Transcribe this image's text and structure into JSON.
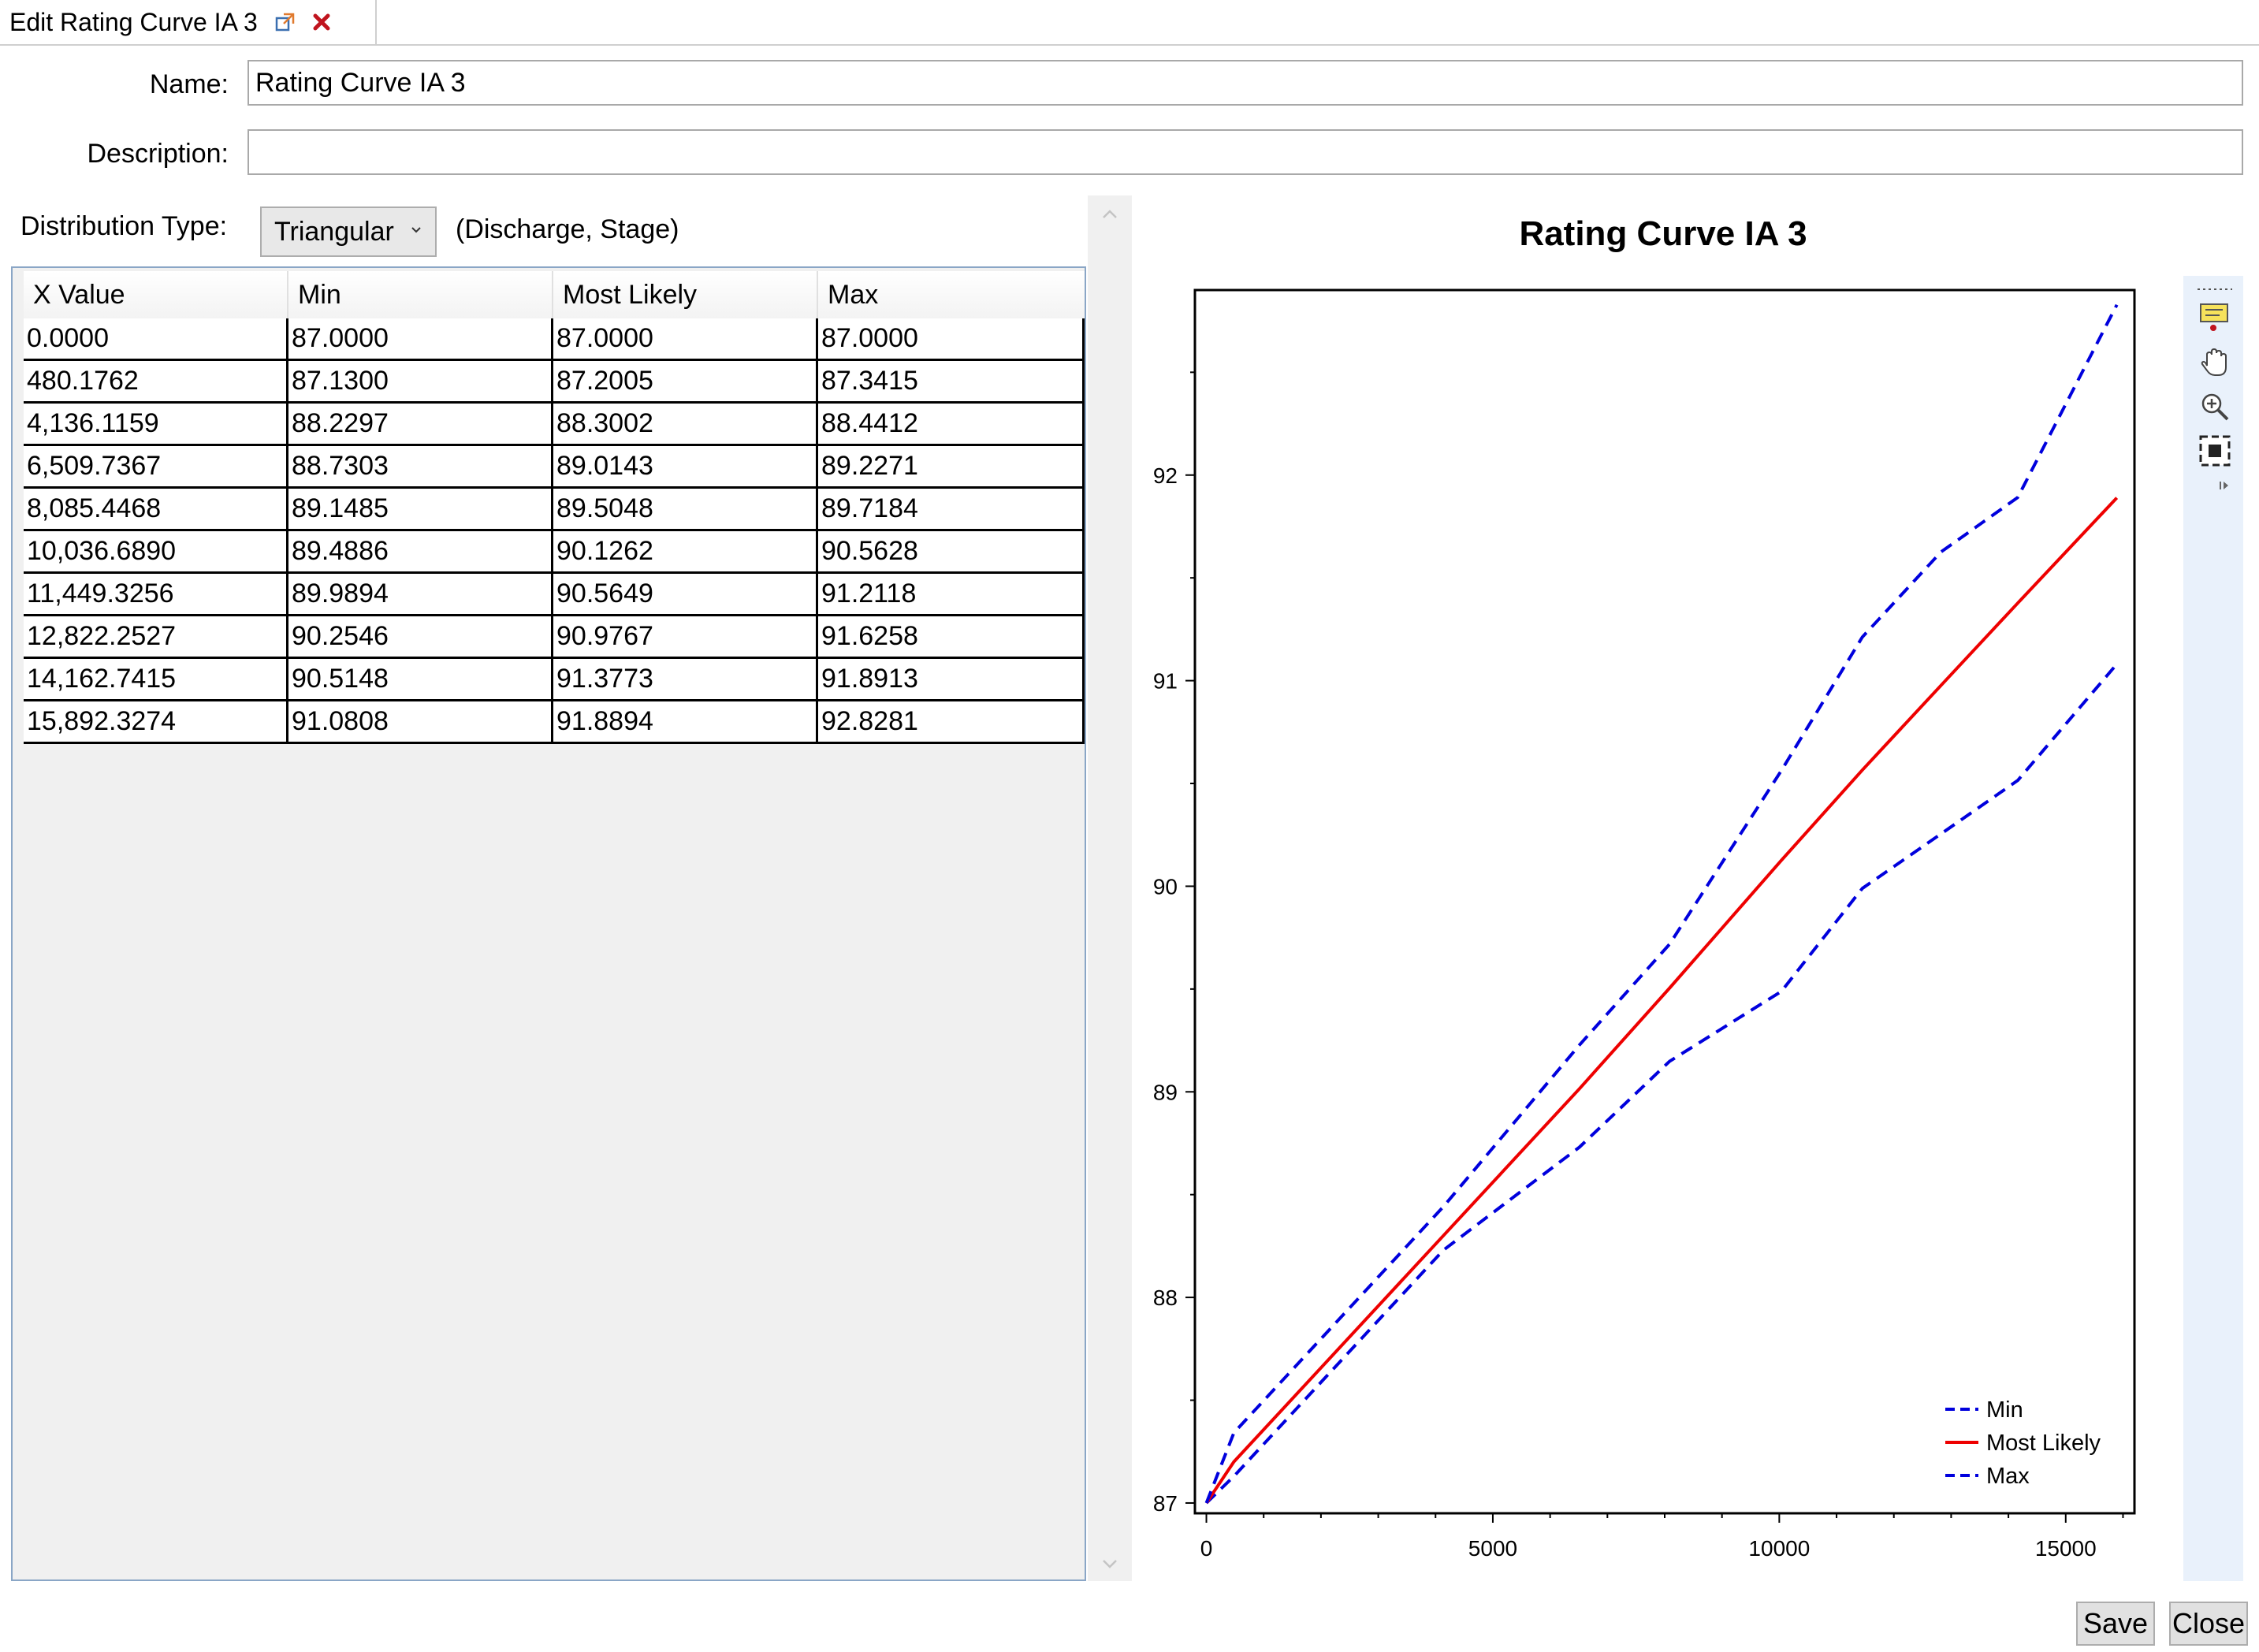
{
  "tab": {
    "title": "Edit Rating Curve IA 3"
  },
  "form": {
    "name_label": "Name:",
    "name_value": "Rating Curve IA 3",
    "description_label": "Description:",
    "description_value": "",
    "distribution_label": "Distribution Type:",
    "distribution_value": "Triangular",
    "units_note": "(Discharge, Stage)"
  },
  "table": {
    "columns": [
      "X Value",
      "Min",
      "Most Likely",
      "Max"
    ],
    "rows": [
      [
        "0.0000",
        "87.0000",
        "87.0000",
        "87.0000"
      ],
      [
        "480.1762",
        "87.1300",
        "87.2005",
        "87.3415"
      ],
      [
        "4,136.1159",
        "88.2297",
        "88.3002",
        "88.4412"
      ],
      [
        "6,509.7367",
        "88.7303",
        "89.0143",
        "89.2271"
      ],
      [
        "8,085.4468",
        "89.1485",
        "89.5048",
        "89.7184"
      ],
      [
        "10,036.6890",
        "89.4886",
        "90.1262",
        "90.5628"
      ],
      [
        "11,449.3256",
        "89.9894",
        "90.5649",
        "91.2118"
      ],
      [
        "12,822.2527",
        "90.2546",
        "90.9767",
        "91.6258"
      ],
      [
        "14,162.7415",
        "90.5148",
        "91.3773",
        "91.8913"
      ],
      [
        "15,892.3274",
        "91.0808",
        "91.8894",
        "92.8281"
      ]
    ]
  },
  "chart_data": {
    "type": "line",
    "title": "Rating Curve IA 3",
    "xlabel": "",
    "ylabel": "",
    "xlim": [
      -200,
      16200
    ],
    "ylim": [
      86.95,
      92.9
    ],
    "x_ticks": [
      0,
      5000,
      10000,
      15000
    ],
    "y_ticks": [
      87,
      88,
      89,
      90,
      91,
      92
    ],
    "x": [
      0,
      480.1762,
      4136.1159,
      6509.7367,
      8085.4468,
      10036.689,
      11449.3256,
      12822.2527,
      14162.7415,
      15892.3274
    ],
    "series": [
      {
        "name": "Min",
        "color": "#0000dd",
        "dash": true,
        "values": [
          87.0,
          87.13,
          88.2297,
          88.7303,
          89.1485,
          89.4886,
          89.9894,
          90.2546,
          90.5148,
          91.0808
        ]
      },
      {
        "name": "Most Likely",
        "color": "#ee0000",
        "dash": false,
        "values": [
          87.0,
          87.2005,
          88.3002,
          89.0143,
          89.5048,
          90.1262,
          90.5649,
          90.9767,
          91.3773,
          91.8894
        ]
      },
      {
        "name": "Max",
        "color": "#0000dd",
        "dash": true,
        "values": [
          87.0,
          87.3415,
          88.4412,
          89.2271,
          89.7184,
          90.5628,
          91.2118,
          91.6258,
          91.8913,
          92.8281
        ]
      }
    ],
    "grid": false,
    "legend": "bottom-right"
  },
  "toolbar": {
    "icons": [
      "annotation-icon",
      "pan-hand-icon",
      "zoom-icon",
      "zoom-extents-icon"
    ]
  },
  "buttons": {
    "save": "Save",
    "close": "Close"
  },
  "colors": {
    "accent_blue": "#0000dd",
    "accent_red": "#ee0000",
    "panel_border": "#8aa6c6"
  }
}
